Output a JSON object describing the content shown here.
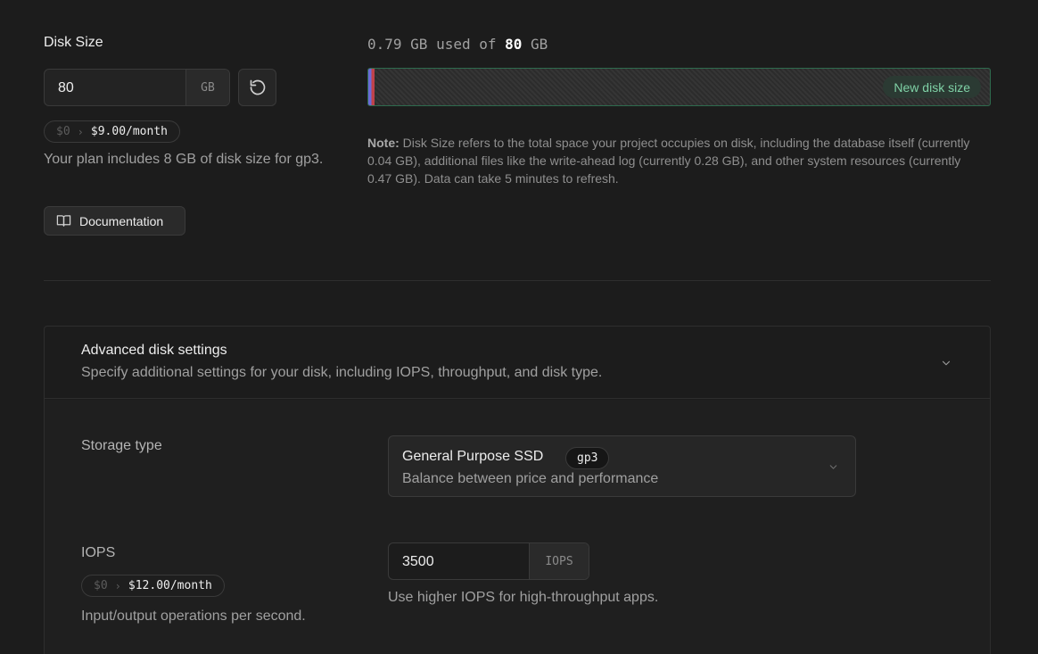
{
  "disk": {
    "title": "Disk Size",
    "value": "80",
    "unit": "GB",
    "price_old": "$0",
    "price_new": "$9.00/month",
    "plan_text": "Your plan includes 8 GB of disk size for gp3.",
    "doc_button": "Documentation",
    "reset_icon": "reset-icon",
    "doc_icon": "book-icon"
  },
  "usage": {
    "used_prefix": "0.79 GB used of",
    "total": "80",
    "total_unit": "GB",
    "fill_fraction": 0.0099,
    "new_size_tag": "New disk size",
    "note_label": "Note:",
    "note_text": "Disk Size refers to the total space your project occupies on disk, including the database itself (currently 0.04 GB), additional files like the write-ahead log (currently 0.28 GB), and other system resources (currently 0.47 GB). Data can take 5 minutes to refresh."
  },
  "advanced": {
    "title": "Advanced disk settings",
    "description": "Specify additional settings for your disk, including IOPS, throughput, and disk type.",
    "chevron_icon": "chevron-down-icon",
    "storage": {
      "label": "Storage type",
      "selected_name": "General Purpose SSD",
      "selected_code": "gp3",
      "selected_sub": "Balance between price and performance"
    },
    "iops": {
      "label": "IOPS",
      "price_old": "$0",
      "price_new": "$12.00/month",
      "description": "Input/output operations per second.",
      "value": "3500",
      "unit": "IOPS",
      "help": "Use higher IOPS for high-throughput apps."
    }
  },
  "colors": {
    "background": "#1c1c1c",
    "accent_green": "#7fd1a6",
    "bar_border": "#2e6b4e"
  }
}
